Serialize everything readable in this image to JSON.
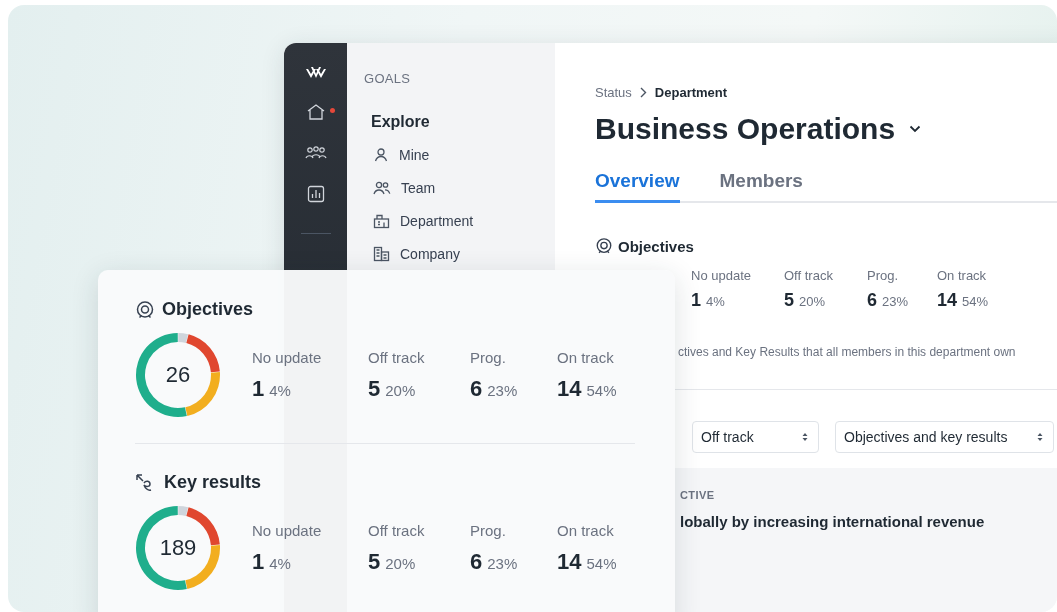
{
  "nav": {
    "heading": "GOALS",
    "section_title": "Explore",
    "items": [
      {
        "label": "Mine"
      },
      {
        "label": "Team"
      },
      {
        "label": "Department"
      },
      {
        "label": "Company"
      }
    ]
  },
  "main": {
    "breadcrumb": [
      "Status",
      "Department"
    ],
    "title": "Business Operations",
    "tabs": [
      {
        "label": "Overview",
        "selected": true
      },
      {
        "label": "Members",
        "selected": false
      }
    ],
    "objectives": {
      "heading": "Objectives",
      "stats": [
        {
          "label": "No update",
          "count": "1",
          "percent": "4%"
        },
        {
          "label": "Off track",
          "count": "5",
          "percent": "20%"
        },
        {
          "label": "Prog.",
          "count": "6",
          "percent": "23%"
        },
        {
          "label": "On track",
          "count": "14",
          "percent": "54%"
        }
      ]
    },
    "description": "ctives and Key Results that all members in this department own",
    "filters": [
      {
        "value": "Off track"
      },
      {
        "value": "Objectives and key results"
      }
    ],
    "list": {
      "column_1": "CTIVE",
      "row": "lobally by increasing international revenue"
    }
  },
  "summary_card": {
    "sections": [
      {
        "kind": "objectives",
        "heading": "Objectives",
        "total": "26",
        "stats": [
          {
            "count": "1",
            "percent": "4%"
          },
          {
            "count": "5",
            "percent": "20%"
          },
          {
            "count": "6",
            "percent": "23%"
          },
          {
            "count": "14",
            "percent": "54%"
          }
        ],
        "chart_data": {
          "type": "donut",
          "categories": [
            "No update",
            "Off track",
            "Prog.",
            "On track"
          ],
          "series": [
            {
              "values": [
                4,
                20,
                23,
                54
              ]
            }
          ]
        }
      },
      {
        "kind": "key_results",
        "heading": "Key results",
        "total": "189",
        "stats": [
          {
            "count": "1",
            "percent": "4%"
          },
          {
            "count": "5",
            "percent": "20%"
          },
          {
            "count": "6",
            "percent": "23%"
          },
          {
            "count": "14",
            "percent": "54%"
          }
        ],
        "chart_data": {
          "type": "donut",
          "categories": [
            "No update",
            "Off track",
            "Prog.",
            "On track"
          ],
          "series": [
            {
              "values": [
                4,
                20,
                23,
                54
              ]
            }
          ]
        }
      }
    ]
  }
}
